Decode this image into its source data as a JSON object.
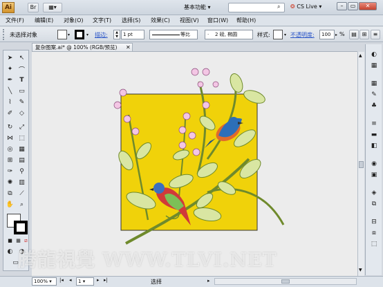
{
  "app": {
    "logo": "Ai",
    "workspace": "基本功能",
    "live": "CS Live"
  },
  "menus": [
    "文件(F)",
    "编辑(E)",
    "对象(O)",
    "文字(T)",
    "选择(S)",
    "效果(C)",
    "视图(V)",
    "窗口(W)",
    "帮助(H)"
  ],
  "control": {
    "selection": "未选择对象",
    "stroke_label": "描边:",
    "stroke_value": "1 pt",
    "line_label": "等比",
    "brush_label": "2 磅, 椭圆",
    "style_label": "样式:",
    "opacity_label": "不透明度:",
    "opacity_value": "100",
    "opacity_unit": "%"
  },
  "document": {
    "tab": "复杂图案.ai* @ 100% (RGB/预览)",
    "zoom": "100%",
    "page": "1",
    "status": "选择"
  },
  "watermark": "腾龍視覺 WWW.TLVI.NET",
  "colors": {
    "artboard": "#f0d20a",
    "accent_link": "#2a55c8"
  }
}
